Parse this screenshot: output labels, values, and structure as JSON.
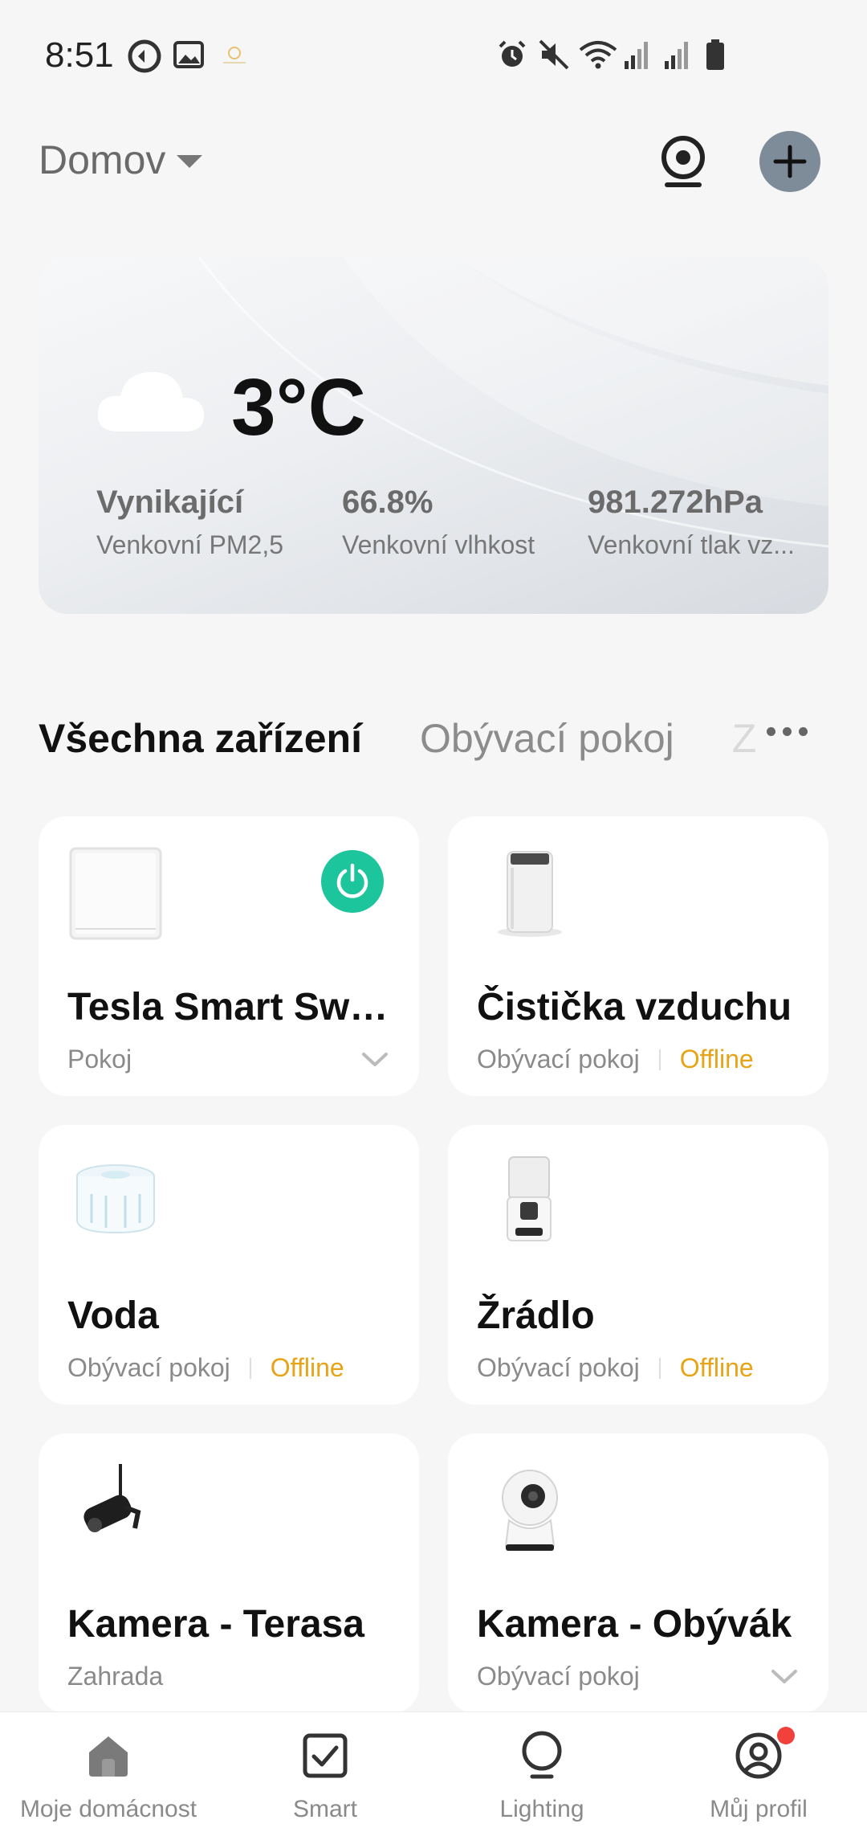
{
  "status_bar": {
    "time": "8:51",
    "icons": [
      "app-notification-icon",
      "gallery-icon",
      "weather-icon",
      "alarm-icon",
      "mute-icon",
      "wifi-icon",
      "signal-icon",
      "signal-icon",
      "battery-icon"
    ]
  },
  "header": {
    "home_name": "Domov",
    "camera_icon": "camera-icon",
    "add_icon": "plus-icon"
  },
  "weather": {
    "temperature": "3°C",
    "icon": "cloud-icon",
    "stats": [
      {
        "value": "Vynikající",
        "label": "Venkovní PM2,5"
      },
      {
        "value": "66.8%",
        "label": "Venkovní vlhkost"
      },
      {
        "value": "981.272hPa",
        "label": "Venkovní tlak vz..."
      }
    ]
  },
  "tabs": [
    {
      "label": "Všechna zařízení",
      "active": true
    },
    {
      "label": "Obývací pokoj",
      "active": false
    },
    {
      "label": "Z",
      "active": false
    }
  ],
  "devices": [
    {
      "name": "Tesla Smart Swi...",
      "room": "Pokoj",
      "status": "",
      "icon": "wall-switch-icon",
      "power": true
    },
    {
      "name": "Čistička vzduchu",
      "room": "Obývací pokoj",
      "status": "Offline",
      "icon": "air-purifier-icon"
    },
    {
      "name": "Voda",
      "room": "Obývací pokoj",
      "status": "Offline",
      "icon": "water-fountain-icon"
    },
    {
      "name": "Žrádlo",
      "room": "Obývací pokoj",
      "status": "Offline",
      "icon": "pet-feeder-icon"
    },
    {
      "name": "Kamera - Terasa",
      "room": "Zahrada",
      "status": "",
      "icon": "outdoor-camera-icon"
    },
    {
      "name": "Kamera - Obývák",
      "room": "Obývací pokoj",
      "status": "",
      "icon": "indoor-camera-icon"
    }
  ],
  "bottom_nav": [
    {
      "label": "Moje domácnost",
      "icon": "home-icon"
    },
    {
      "label": "Smart",
      "icon": "checkbox-icon"
    },
    {
      "label": "Lighting",
      "icon": "bulb-icon"
    },
    {
      "label": "Můj profil",
      "icon": "profile-icon"
    }
  ],
  "colors": {
    "accent_green": "#1cc59b",
    "offline": "#e8a317",
    "add_button": "#7e8b99",
    "badge": "#f2403a"
  }
}
